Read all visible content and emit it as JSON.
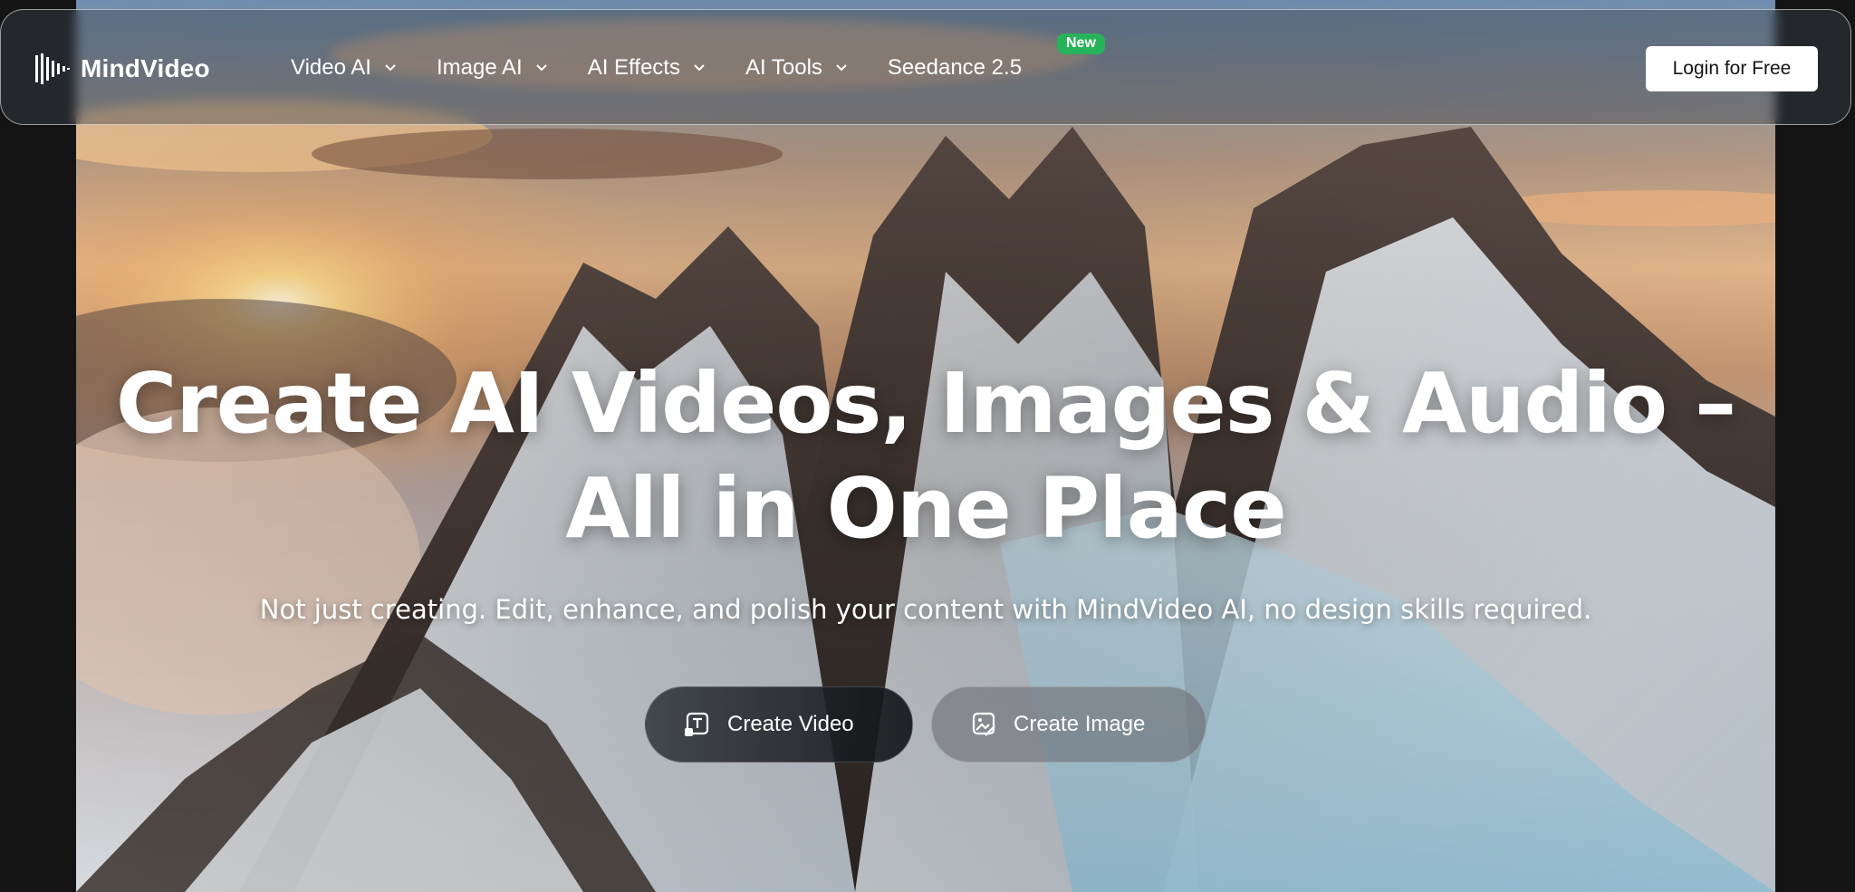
{
  "brand": {
    "name": "MindVideo",
    "icon": "mindvideo-logo-icon"
  },
  "nav": {
    "items": [
      {
        "label": "Video AI",
        "icon": "chevron-down-icon"
      },
      {
        "label": "Image AI",
        "icon": "chevron-down-icon"
      },
      {
        "label": "AI Effects",
        "icon": "chevron-down-icon"
      },
      {
        "label": "AI Tools",
        "icon": "chevron-down-icon"
      },
      {
        "label": "Seedance 2.5",
        "badge": "New"
      }
    ],
    "login_label": "Login for Free"
  },
  "hero": {
    "title_line1": "Create AI Videos, Images & Audio –",
    "title_line2": "All in One Place",
    "subtitle": "Not just creating. Edit, enhance, and polish your content with MindVideo AI, no design skills required.",
    "buttons": [
      {
        "label": "Create Video",
        "icon": "text-video-icon"
      },
      {
        "label": "Create Image",
        "icon": "image-edit-icon"
      }
    ]
  },
  "colors": {
    "badge": "#27b35a",
    "login_bg": "#ffffff",
    "page_bg": "#141414"
  }
}
